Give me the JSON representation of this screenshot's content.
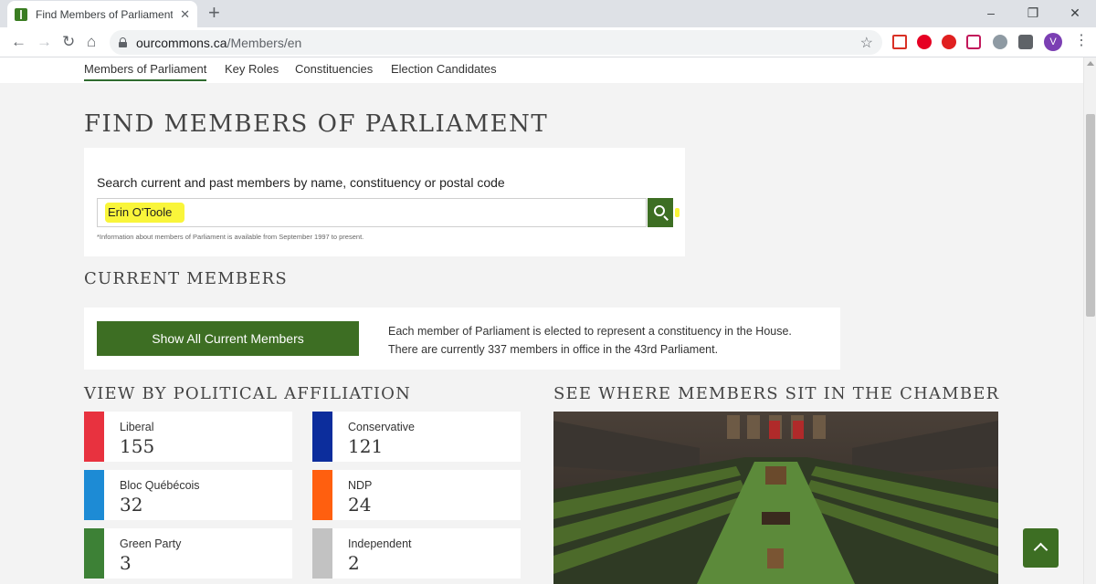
{
  "browser": {
    "tab_title": "Find Members of Parliament - M",
    "url_domain": "ourcommons.ca",
    "url_path": "/Members/en",
    "profile_initial": "V",
    "extensions": [
      "gmail-icon",
      "pinterest-icon",
      "adblock-plus-icon",
      "pocket-icon",
      "drive-icon",
      "extensions-puzzle-icon"
    ]
  },
  "subnav": {
    "items": [
      "Members of Parliament",
      "Key Roles",
      "Constituencies",
      "Election Candidates"
    ],
    "active": "Members of Parliament"
  },
  "heading": "FIND MEMBERS OF PARLIAMENT",
  "search": {
    "label": "Search current and past members by name, constituency or postal code",
    "value": "Erin O'Toole",
    "note": "*Information about members of Parliament is available from September 1997 to present."
  },
  "current": {
    "heading": "CURRENT MEMBERS",
    "button_label": "Show All Current Members",
    "desc_line1": "Each member of Parliament is elected to represent a constituency in the House.",
    "desc_line2": "There are currently 337 members in office in the 43rd Parliament."
  },
  "affiliation": {
    "heading": "VIEW BY POLITICAL AFFILIATION",
    "parties": [
      {
        "name": "Liberal",
        "count": "155",
        "color": "#e8323f"
      },
      {
        "name": "Conservative",
        "count": "121",
        "color": "#0c2d9c"
      },
      {
        "name": "Bloc Québécois",
        "count": "32",
        "color": "#1d8bd5"
      },
      {
        "name": "NDP",
        "count": "24",
        "color": "#ff5f0f"
      },
      {
        "name": "Green Party",
        "count": "3",
        "color": "#3d8136"
      },
      {
        "name": "Independent",
        "count": "2",
        "color": "#c2c2c2"
      }
    ]
  },
  "chamber": {
    "heading": "SEE WHERE MEMBERS SIT IN THE CHAMBER"
  },
  "colors": {
    "accent": "#3d6e23",
    "highlight": "#f9f53a"
  }
}
